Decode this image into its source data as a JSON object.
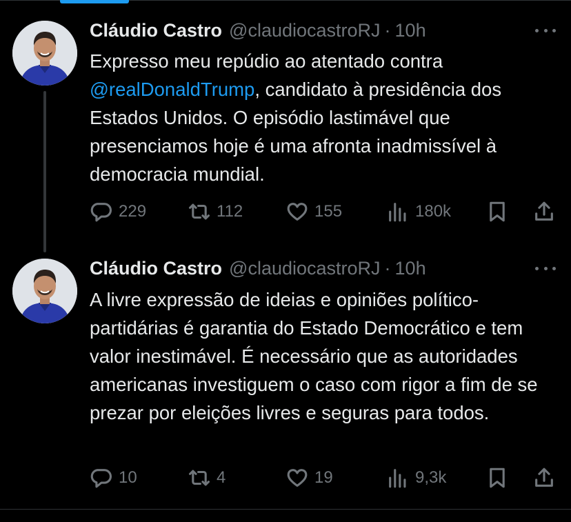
{
  "tweets": [
    {
      "author": "Cláudio Castro",
      "handle": "@claudiocastroRJ",
      "separator": "·",
      "time": "10h",
      "text_before": "Expresso meu repúdio ao atentado contra ",
      "mention": "@realDonaldTrump",
      "text_after": ", candidato à presidência dos Estados Unidos. O episódio lastimável que presenciamos hoje é uma afronta inadmissível à democracia mundial.",
      "replies": "229",
      "retweets": "112",
      "likes": "155",
      "views": "180k"
    },
    {
      "author": "Cláudio Castro",
      "handle": "@claudiocastroRJ",
      "separator": "·",
      "time": "10h",
      "text": "A livre expressão de ideias e opiniões político-partidárias é garantia do Estado Democrático e tem valor inestimável. É necessário que as autoridades americanas investiguem o caso com rigor a fim de se prezar por eleições livres e seguras para todos.",
      "replies": "10",
      "retweets": "4",
      "likes": "19",
      "views": "9,3k"
    }
  ],
  "colors": {
    "background": "#000000",
    "text": "#e7e9ea",
    "secondary": "#71767b",
    "accent": "#1d9bf0",
    "divider": "#2f3336"
  },
  "icons": [
    "reply-icon",
    "retweet-icon",
    "like-icon",
    "views-icon",
    "bookmark-icon",
    "share-icon",
    "more-icon"
  ]
}
